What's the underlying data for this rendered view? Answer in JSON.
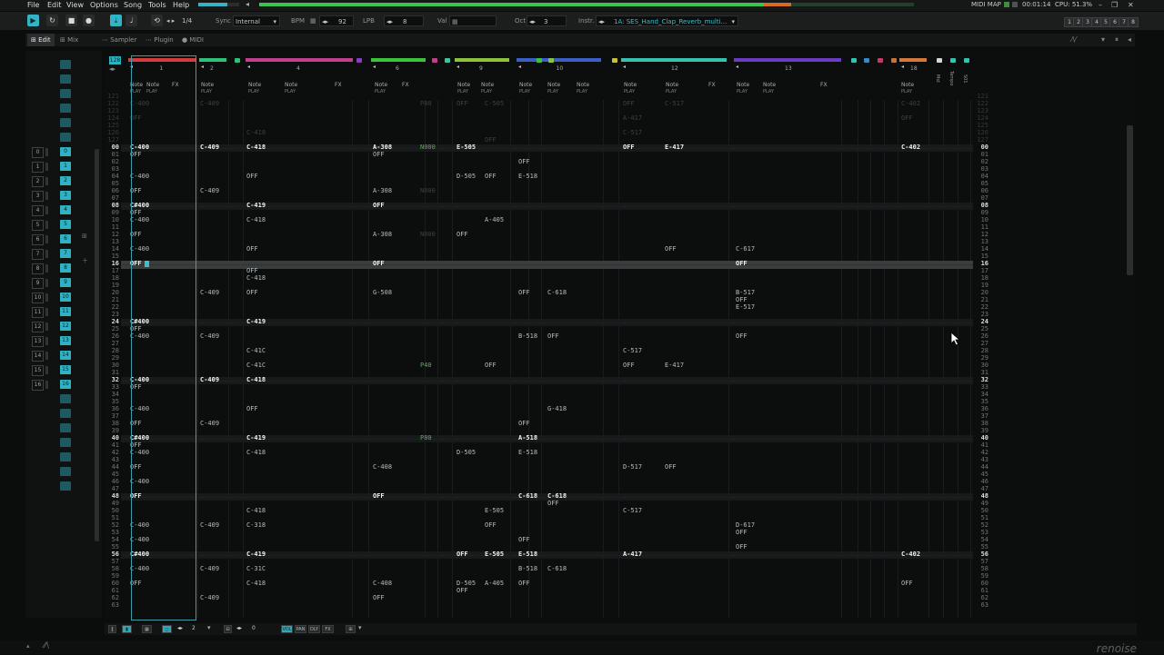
{
  "menu": [
    "File",
    "Edit",
    "View",
    "Options",
    "Song",
    "Tools",
    "Help"
  ],
  "status_bar": {
    "midi_map": "MIDI MAP",
    "time": "00:01:14",
    "cpu": "CPU: 51.3%"
  },
  "transport": {
    "pattern_count": "1/4",
    "sync_label": "Sync",
    "sync_value": "Internal",
    "bpm_label": "BPM",
    "bpm_value": "92",
    "lpb_label": "LPB",
    "lpb_value": "8",
    "val_label": "Val",
    "oct_label": "Oct",
    "oct_value": "3",
    "instr_label": "Instr.",
    "instr_value": "1A: SES_Hand_Clap_Reverb_multi..."
  },
  "keys": [
    "1",
    "2",
    "3",
    "4",
    "5",
    "6",
    "7",
    "8"
  ],
  "tabs": [
    "Edit",
    "Mix",
    "Sampler",
    "Plugin",
    "MIDI"
  ],
  "sequence": {
    "numbers": [
      "0",
      "1",
      "2",
      "3",
      "4",
      "5",
      "6",
      "7",
      "8",
      "9",
      "10",
      "11",
      "12",
      "13",
      "14",
      "15",
      "16"
    ],
    "side_icons": [
      "sequence-play-icon",
      "add-pattern-icon"
    ]
  },
  "pattern": {
    "pattern_length": "128",
    "track_header": {
      "note_label": "Note",
      "fx_label": "FX",
      "play_label": "PLAY",
      "master_label": "Mst",
      "tempo_label": "Tempo",
      "s01_label": "S01"
    },
    "tracks": [
      {
        "num": "1",
        "color": "#d43c3c"
      },
      {
        "num": "2",
        "color": "#2fc07a"
      },
      {
        "num": "4",
        "color": "#c23f8c"
      },
      {
        "num": "6",
        "color": "#3bc43b"
      },
      {
        "num": "9",
        "color": "#8cc23c"
      },
      {
        "num": "10",
        "color": "#3b5ec4"
      },
      {
        "num": "12",
        "color": "#35c2b0"
      },
      {
        "num": "13",
        "color": "#6b3cc2"
      },
      {
        "num": "18",
        "color": "#d7783b"
      }
    ],
    "rows_top": [
      "00",
      "01",
      "02",
      "03",
      "04",
      "05",
      "06",
      "07",
      "08",
      "09",
      "10",
      "11",
      "12",
      "13",
      "14",
      "15",
      "16",
      "17",
      "18",
      "19",
      "20",
      "21",
      "22",
      "23",
      "24",
      "25",
      "26",
      "27",
      "28",
      "29",
      "30",
      "31",
      "32",
      "33",
      "34",
      "35",
      "36",
      "37",
      "38",
      "39",
      "40",
      "41",
      "42",
      "43",
      "44",
      "45",
      "46",
      "47",
      "48",
      "49",
      "50",
      "51",
      "52",
      "53",
      "54",
      "55",
      "56",
      "57",
      "58",
      "59",
      "60",
      "61",
      "62",
      "63"
    ],
    "ghost_rows": [
      "121",
      "122",
      "123",
      "124",
      "125",
      "126",
      "127"
    ],
    "cells": [
      {
        "r": 0,
        "c": 0,
        "t": "C-400",
        "h": true
      },
      {
        "r": 0,
        "c": 1,
        "t": "C-409",
        "h": true
      },
      {
        "r": 0,
        "c": 2,
        "t": "C-418",
        "h": true
      },
      {
        "r": 0,
        "c": 3,
        "t": "A-308",
        "h": true
      },
      {
        "r": 0,
        "c": 4,
        "t": "N000",
        "fx": true
      },
      {
        "r": 0,
        "c": 5,
        "t": "E-505",
        "h": true
      },
      {
        "r": 0,
        "c": 8,
        "t": "OFF",
        "h": true
      },
      {
        "r": 0,
        "c": 9,
        "t": "E-417",
        "h": true
      },
      {
        "r": 0,
        "c": 11,
        "t": "C-402",
        "h": true
      },
      {
        "r": 1,
        "c": 0,
        "t": "OFF"
      },
      {
        "r": 1,
        "c": 3,
        "t": "OFF"
      },
      {
        "r": 2,
        "c": 7,
        "t": "OFF"
      },
      {
        "r": 4,
        "c": 0,
        "t": "C-400"
      },
      {
        "r": 4,
        "c": 2,
        "t": "OFF"
      },
      {
        "r": 4,
        "c": 5,
        "t": "D-505"
      },
      {
        "r": 4,
        "c": 6,
        "t": "OFF"
      },
      {
        "r": 4,
        "c": 7,
        "t": "E-518"
      },
      {
        "r": 6,
        "c": 0,
        "t": "OFF"
      },
      {
        "r": 6,
        "c": 1,
        "t": "C-409"
      },
      {
        "r": 6,
        "c": 3,
        "t": "A-308"
      },
      {
        "r": 6,
        "c": 4,
        "t": "N000",
        "dim": true
      },
      {
        "r": 8,
        "c": 0,
        "t": "C#400",
        "h": true
      },
      {
        "r": 8,
        "c": 2,
        "t": "C-419",
        "h": true
      },
      {
        "r": 8,
        "c": 3,
        "t": "OFF",
        "h": true
      },
      {
        "r": 9,
        "c": 0,
        "t": "OFF"
      },
      {
        "r": 10,
        "c": 0,
        "t": "C-400"
      },
      {
        "r": 10,
        "c": 2,
        "t": "C-418"
      },
      {
        "r": 10,
        "c": 6,
        "t": "A-405"
      },
      {
        "r": 12,
        "c": 0,
        "t": "OFF"
      },
      {
        "r": 12,
        "c": 3,
        "t": "A-308"
      },
      {
        "r": 12,
        "c": 4,
        "t": "N000",
        "dim": true
      },
      {
        "r": 12,
        "c": 5,
        "t": "OFF"
      },
      {
        "r": 14,
        "c": 0,
        "t": "C-400"
      },
      {
        "r": 14,
        "c": 2,
        "t": "OFF"
      },
      {
        "r": 14,
        "c": 9,
        "t": "OFF"
      },
      {
        "r": 14,
        "c": 10,
        "t": "C-617"
      },
      {
        "r": 16,
        "c": 0,
        "t": "OFF",
        "h": true
      },
      {
        "r": 16,
        "c": 3,
        "t": "OFF",
        "h": true
      },
      {
        "r": 16,
        "c": 10,
        "t": "OFF",
        "h": true
      },
      {
        "r": 17,
        "c": 2,
        "t": "OFF"
      },
      {
        "r": 18,
        "c": 2,
        "t": "C-418"
      },
      {
        "r": 20,
        "c": 1,
        "t": "C-409"
      },
      {
        "r": 20,
        "c": 2,
        "t": "OFF"
      },
      {
        "r": 20,
        "c": 3,
        "t": "G-508"
      },
      {
        "r": 20,
        "c": 7,
        "t": "OFF"
      },
      {
        "r": 20,
        "c": 12,
        "t": "C-618"
      },
      {
        "r": 20,
        "c": 10,
        "t": "B-517"
      },
      {
        "r": 21,
        "c": 10,
        "t": "OFF"
      },
      {
        "r": 22,
        "c": 10,
        "t": "E-517"
      },
      {
        "r": 24,
        "c": 0,
        "t": "C#400",
        "h": true
      },
      {
        "r": 24,
        "c": 2,
        "t": "C-419",
        "h": true
      },
      {
        "r": 25,
        "c": 0,
        "t": "OFF"
      },
      {
        "r": 26,
        "c": 0,
        "t": "C-400"
      },
      {
        "r": 26,
        "c": 1,
        "t": "C-409"
      },
      {
        "r": 26,
        "c": 7,
        "t": "B-518"
      },
      {
        "r": 26,
        "c": 12,
        "t": "OFF"
      },
      {
        "r": 26,
        "c": 10,
        "t": "OFF"
      },
      {
        "r": 28,
        "c": 2,
        "t": "C-41C"
      },
      {
        "r": 28,
        "c": 8,
        "t": "C-517"
      },
      {
        "r": 30,
        "c": 2,
        "t": "C-41C"
      },
      {
        "r": 30,
        "c": 4,
        "t": "P40",
        "fx": true
      },
      {
        "r": 30,
        "c": 6,
        "t": "OFF"
      },
      {
        "r": 30,
        "c": 8,
        "t": "OFF"
      },
      {
        "r": 30,
        "c": 9,
        "t": "E-417"
      },
      {
        "r": 32,
        "c": 0,
        "t": "C-400",
        "h": true
      },
      {
        "r": 32,
        "c": 1,
        "t": "C-409",
        "h": true
      },
      {
        "r": 32,
        "c": 2,
        "t": "C-418",
        "h": true
      },
      {
        "r": 33,
        "c": 0,
        "t": "OFF"
      },
      {
        "r": 36,
        "c": 0,
        "t": "C-400"
      },
      {
        "r": 36,
        "c": 2,
        "t": "OFF"
      },
      {
        "r": 36,
        "c": 12,
        "t": "G-418"
      },
      {
        "r": 38,
        "c": 0,
        "t": "OFF"
      },
      {
        "r": 38,
        "c": 1,
        "t": "C-409"
      },
      {
        "r": 38,
        "c": 7,
        "t": "OFF"
      },
      {
        "r": 40,
        "c": 0,
        "t": "C#400",
        "h": true
      },
      {
        "r": 40,
        "c": 2,
        "t": "C-419",
        "h": true
      },
      {
        "r": 40,
        "c": 4,
        "t": "P80",
        "fx": true
      },
      {
        "r": 40,
        "c": 7,
        "t": "A-518",
        "h": true
      },
      {
        "r": 41,
        "c": 0,
        "t": "OFF"
      },
      {
        "r": 42,
        "c": 0,
        "t": "C-400"
      },
      {
        "r": 42,
        "c": 2,
        "t": "C-418"
      },
      {
        "r": 42,
        "c": 5,
        "t": "D-505"
      },
      {
        "r": 42,
        "c": 7,
        "t": "E-518"
      },
      {
        "r": 44,
        "c": 0,
        "t": "OFF"
      },
      {
        "r": 44,
        "c": 3,
        "t": "C-408"
      },
      {
        "r": 44,
        "c": 8,
        "t": "D-517"
      },
      {
        "r": 44,
        "c": 9,
        "t": "OFF"
      },
      {
        "r": 46,
        "c": 0,
        "t": "C-400"
      },
      {
        "r": 48,
        "c": 0,
        "t": "OFF",
        "h": true
      },
      {
        "r": 48,
        "c": 3,
        "t": "OFF",
        "h": true
      },
      {
        "r": 48,
        "c": 7,
        "t": "C-618",
        "h": true
      },
      {
        "r": 48,
        "c": 12,
        "t": "C-618",
        "h": true
      },
      {
        "r": 49,
        "c": 12,
        "t": "OFF"
      },
      {
        "r": 50,
        "c": 2,
        "t": "C-418"
      },
      {
        "r": 50,
        "c": 6,
        "t": "E-505"
      },
      {
        "r": 50,
        "c": 8,
        "t": "C-517"
      },
      {
        "r": 52,
        "c": 0,
        "t": "C-400"
      },
      {
        "r": 52,
        "c": 1,
        "t": "C-409"
      },
      {
        "r": 52,
        "c": 2,
        "t": "C-318"
      },
      {
        "r": 52,
        "c": 6,
        "t": "OFF"
      },
      {
        "r": 52,
        "c": 10,
        "t": "D-617"
      },
      {
        "r": 53,
        "c": 10,
        "t": "OFF"
      },
      {
        "r": 54,
        "c": 0,
        "t": "C-400"
      },
      {
        "r": 54,
        "c": 7,
        "t": "OFF"
      },
      {
        "r": 55,
        "c": 10,
        "t": "OFF"
      },
      {
        "r": 56,
        "c": 0,
        "t": "C#400",
        "h": true
      },
      {
        "r": 56,
        "c": 2,
        "t": "C-419",
        "h": true
      },
      {
        "r": 56,
        "c": 5,
        "t": "OFF",
        "h": true
      },
      {
        "r": 56,
        "c": 6,
        "t": "E-505",
        "h": true
      },
      {
        "r": 56,
        "c": 7,
        "t": "E-518",
        "h": true
      },
      {
        "r": 56,
        "c": 8,
        "t": "A-417",
        "h": true
      },
      {
        "r": 56,
        "c": 11,
        "t": "C-402",
        "h": true
      },
      {
        "r": 58,
        "c": 0,
        "t": "C-400"
      },
      {
        "r": 58,
        "c": 1,
        "t": "C-409"
      },
      {
        "r": 58,
        "c": 2,
        "t": "C-31C"
      },
      {
        "r": 58,
        "c": 7,
        "t": "B-518"
      },
      {
        "r": 58,
        "c": 12,
        "t": "C-618"
      },
      {
        "r": 60,
        "c": 0,
        "t": "OFF"
      },
      {
        "r": 60,
        "c": 2,
        "t": "C-418"
      },
      {
        "r": 60,
        "c": 3,
        "t": "C-408"
      },
      {
        "r": 60,
        "c": 5,
        "t": "D-505"
      },
      {
        "r": 60,
        "c": 6,
        "t": "A-405"
      },
      {
        "r": 60,
        "c": 7,
        "t": "OFF"
      },
      {
        "r": 60,
        "c": 11,
        "t": "OFF"
      },
      {
        "r": 61,
        "c": 5,
        "t": "OFF"
      },
      {
        "r": 62,
        "c": 1,
        "t": "C-409"
      },
      {
        "r": 62,
        "c": 3,
        "t": "OFF"
      }
    ],
    "ghost_cells": [
      {
        "r": 1,
        "c": 0,
        "t": "C-400"
      },
      {
        "r": 1,
        "c": 1,
        "t": "C-409"
      },
      {
        "r": 1,
        "c": 4,
        "t": "P80"
      },
      {
        "r": 1,
        "c": 5,
        "t": "OFF"
      },
      {
        "r": 1,
        "c": 6,
        "t": "C-505"
      },
      {
        "r": 1,
        "c": 8,
        "t": "OFF"
      },
      {
        "r": 1,
        "c": 9,
        "t": "C-517"
      },
      {
        "r": 1,
        "c": 11,
        "t": "C-402"
      },
      {
        "r": 3,
        "c": 0,
        "t": "OFF"
      },
      {
        "r": 3,
        "c": 8,
        "t": "A-417"
      },
      {
        "r": 3,
        "c": 11,
        "t": "OFF"
      },
      {
        "r": 5,
        "c": 2,
        "t": "C-418"
      },
      {
        "r": 5,
        "c": 8,
        "t": "C-517"
      },
      {
        "r": 6,
        "c": 6,
        "t": "OFF"
      }
    ]
  },
  "bottom_bar": {
    "pattern_num": "2",
    "line_val": "0",
    "buttons": [
      "VOL",
      "PAN",
      "DLY",
      "FX"
    ]
  },
  "logo": "renoise"
}
